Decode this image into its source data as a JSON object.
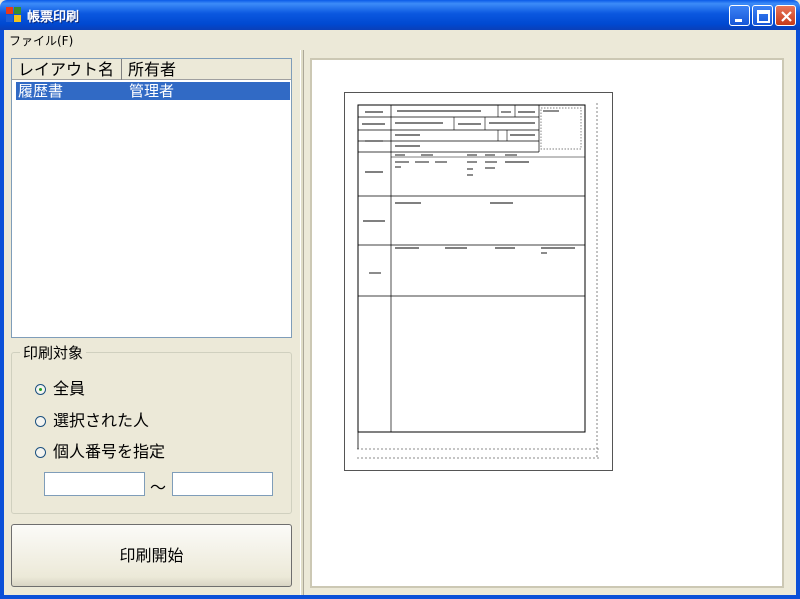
{
  "window": {
    "title": "帳票印刷",
    "controls": [
      "minimize-icon",
      "maximize-icon",
      "close-icon"
    ]
  },
  "menu": {
    "file": "ファイル(F)"
  },
  "layout_list": {
    "columns": [
      "レイアウト名",
      "所有者"
    ],
    "rows": [
      {
        "name": "履歴書",
        "owner": "管理者",
        "selected": true
      }
    ]
  },
  "print_target": {
    "title": "印刷対象",
    "options": [
      {
        "label": "全員",
        "checked": true
      },
      {
        "label": "選択された人",
        "checked": false
      },
      {
        "label": "個人番号を指定",
        "checked": false
      }
    ],
    "range_from": "",
    "range_to": "",
    "range_separator": "～"
  },
  "print_button": {
    "label": "印刷開始"
  },
  "colors": {
    "titlebar": "#0b58e0",
    "selection": "#316ac5",
    "window_bg": "#ece9d8"
  }
}
